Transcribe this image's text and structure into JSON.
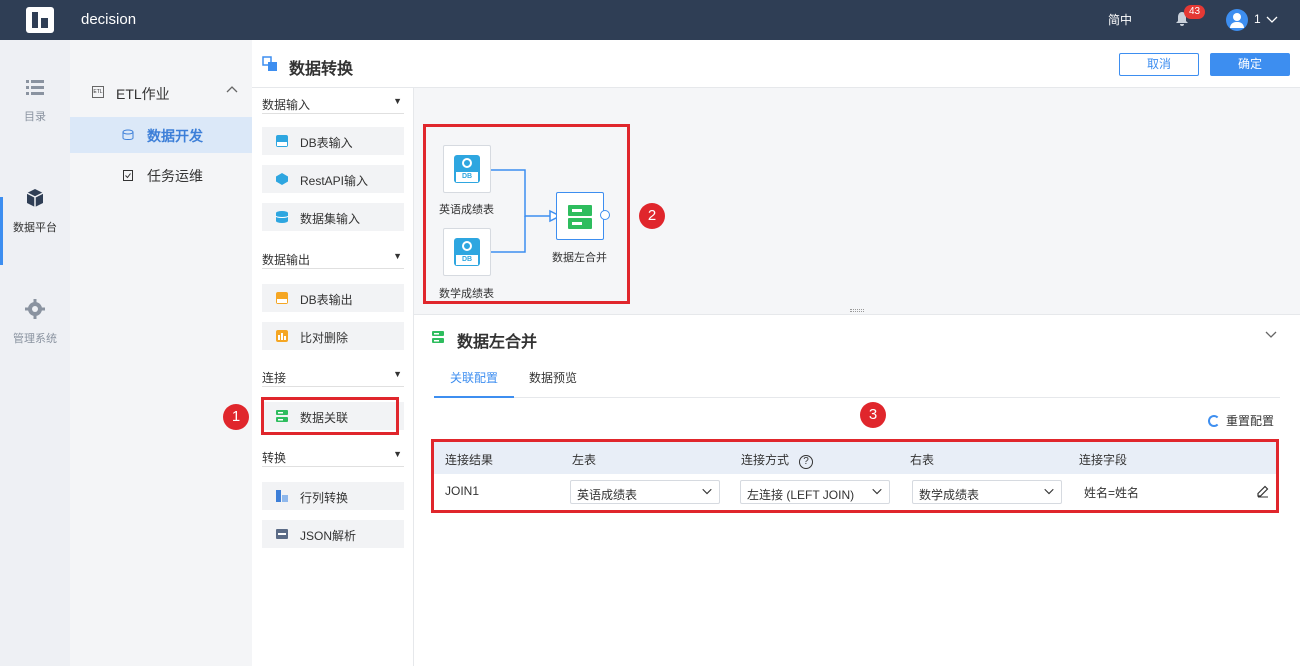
{
  "topbar": {
    "app_title": "decision",
    "language": "简中",
    "notification_count": "43",
    "user_name": "1"
  },
  "rail": {
    "items": [
      {
        "label": "目录"
      },
      {
        "label": "数据平台"
      },
      {
        "label": "管理系统"
      }
    ],
    "active_index": 1
  },
  "nav": {
    "group": {
      "icon_text": "ETL",
      "label": "ETL作业"
    },
    "items": [
      {
        "label": "数据开发",
        "active": true
      },
      {
        "label": "任务运维",
        "active": false
      }
    ]
  },
  "header": {
    "title": "数据转换",
    "cancel_label": "取消",
    "ok_label": "确定"
  },
  "operators": {
    "sections": [
      {
        "label": "数据输入",
        "items": [
          {
            "label": "DB表输入"
          },
          {
            "label": "RestAPI输入"
          },
          {
            "label": "数据集输入"
          }
        ]
      },
      {
        "label": "数据输出",
        "items": [
          {
            "label": "DB表输出"
          },
          {
            "label": "比对删除"
          }
        ]
      },
      {
        "label": "连接",
        "items": [
          {
            "label": "数据关联"
          }
        ]
      },
      {
        "label": "转换",
        "items": [
          {
            "label": "行列转换"
          },
          {
            "label": "JSON解析"
          }
        ]
      }
    ]
  },
  "canvas": {
    "nodes": [
      {
        "label": "英语成绩表",
        "icon_text": "DB"
      },
      {
        "label": "数学成绩表",
        "icon_text": "DB"
      },
      {
        "label": "数据左合并"
      }
    ]
  },
  "props": {
    "title": "数据左合并",
    "tabs": [
      {
        "label": "关联配置",
        "active": true
      },
      {
        "label": "数据预览",
        "active": false
      }
    ],
    "reset_label": "重置配置",
    "table": {
      "headers": [
        "连接结果",
        "左表",
        "连接方式",
        "右表",
        "连接字段"
      ],
      "help_symbol": "?",
      "row": {
        "result": "JOIN1",
        "left_table": "英语成绩表",
        "join_type": "左连接 (LEFT JOIN)",
        "right_table": "数学成绩表",
        "join_field": "姓名=姓名"
      }
    }
  },
  "annotations": [
    "1",
    "2",
    "3"
  ],
  "colors": {
    "topbar": "#2f3e55",
    "accent": "#3d8ef0",
    "annotation": "#e0262c",
    "db_icon": "#2ea6e0",
    "merge_icon": "#2ebd5e"
  }
}
